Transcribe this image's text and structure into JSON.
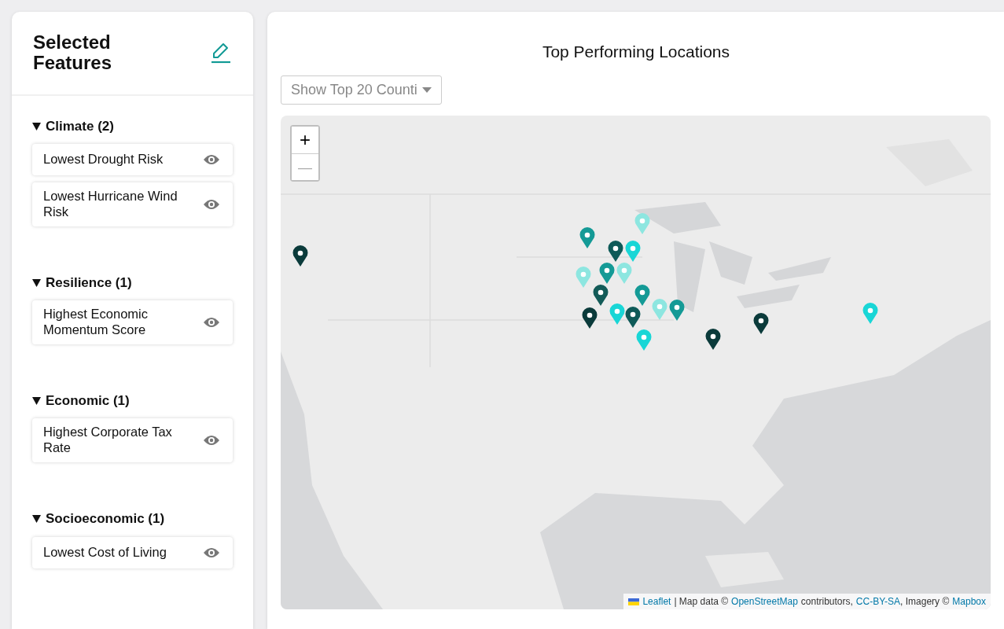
{
  "sidebar": {
    "title": "Selected Features",
    "groups": [
      {
        "label": "Climate (2)",
        "expanded": true,
        "features": [
          "Lowest Drought Risk",
          "Lowest Hurricane Wind Risk"
        ]
      },
      {
        "label": "Resilience (1)",
        "expanded": true,
        "features": [
          "Highest Economic Momentum Score"
        ]
      },
      {
        "label": "Economic (1)",
        "expanded": true,
        "features": [
          "Highest Corporate Tax Rate"
        ]
      },
      {
        "label": "Socioeconomic (1)",
        "expanded": true,
        "features": [
          "Lowest Cost of Living"
        ]
      }
    ]
  },
  "main": {
    "title": "Top Performing Locations",
    "dropdown": "Show Top 20 Counti",
    "map": {
      "zoom_in": "+",
      "zoom_out": "—",
      "markers": [
        {
          "color": "#0b3b3b"
        },
        {
          "color": "#149a96"
        },
        {
          "color": "#8de6e0"
        },
        {
          "color": "#0e5a58"
        },
        {
          "color": "#19d6d6"
        },
        {
          "color": "#149a96"
        },
        {
          "color": "#8de6e0"
        },
        {
          "color": "#8de6e0"
        },
        {
          "color": "#135b58"
        },
        {
          "color": "#149a96"
        },
        {
          "color": "#0b3b3b"
        },
        {
          "color": "#19d6d6"
        },
        {
          "color": "#0e5a58"
        },
        {
          "color": "#8de6e0"
        },
        {
          "color": "#19d6d6"
        },
        {
          "color": "#149a96"
        },
        {
          "color": "#0b3b3b"
        },
        {
          "color": "#0b3b3b"
        },
        {
          "color": "#19d6d6"
        }
      ],
      "attribution": {
        "leaflet": "Leaflet",
        "sep": "| Map data ©",
        "osm": "OpenStreetMap",
        "mid": "contributors,",
        "license": "CC-BY-SA",
        "imagery": ", Imagery ©",
        "mapbox": "Mapbox"
      }
    }
  }
}
